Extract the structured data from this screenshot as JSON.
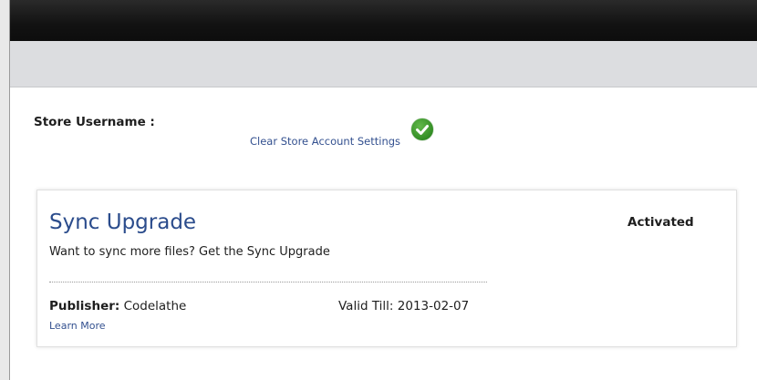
{
  "store": {
    "username_label": "Store Username :",
    "clear_settings_link": "Clear Store Account Settings",
    "status_icon": "checkmark-icon",
    "status_color": "#3a9a2a"
  },
  "product": {
    "title": "Sync Upgrade",
    "description": "Want to sync more files? Get the Sync Upgrade",
    "status": "Activated",
    "publisher_label": "Publisher:",
    "publisher_name": "Codelathe",
    "valid_till_label": "Valid Till:",
    "valid_till_date": "2013-02-07",
    "learn_more_link": "Learn More"
  },
  "colors": {
    "topbar": "#121212",
    "subbar": "#dcdde0",
    "link": "#33508f",
    "title": "#2b4c8c"
  }
}
